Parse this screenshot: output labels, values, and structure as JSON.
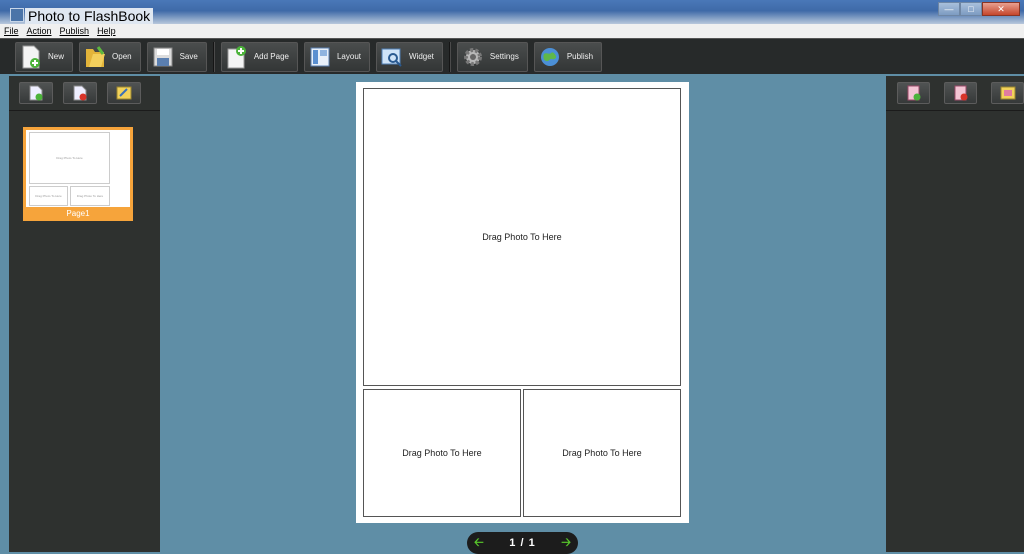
{
  "window": {
    "title": "Photo to FlashBook"
  },
  "menu": {
    "items": [
      "File",
      "Action",
      "Publish",
      "Help"
    ]
  },
  "toolbar": {
    "new_label": "New",
    "open_label": "Open",
    "save_label": "Save",
    "add_page_label": "Add Page",
    "layout_label": "Layout",
    "widget_label": "Widget",
    "settings_label": "Settings",
    "publish_label": "Publish"
  },
  "left_panel": {
    "tools": [
      "add-page-icon",
      "delete-page-icon",
      "edit-page-icon"
    ],
    "pages": [
      {
        "label": "Page1"
      }
    ]
  },
  "right_panel": {
    "tools": [
      "add-photo-icon",
      "remove-photo-icon",
      "edit-photo-icon"
    ]
  },
  "canvas": {
    "slots": [
      "Drag Photo To Here",
      "Drag Photo To Here",
      "Drag Photo To Here"
    ]
  },
  "pager": {
    "indicator": "1 / 1"
  },
  "colors": {
    "background": "#5f8ea6",
    "panel": "#2e312f",
    "toolbar": "#272a2a",
    "thumb_highlight": "#f6a43b",
    "pager_arrow": "#58c82a"
  }
}
